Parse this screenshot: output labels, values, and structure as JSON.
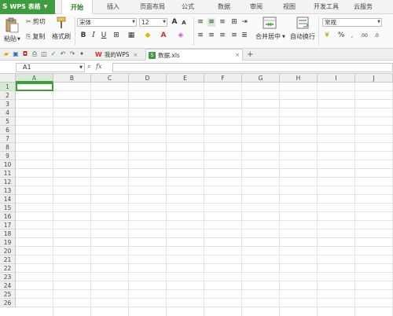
{
  "menu": {
    "app_label": "WPS 表格",
    "tabs": [
      "开始",
      "插入",
      "页面布局",
      "公式",
      "数据",
      "审阅",
      "视图",
      "开发工具",
      "云服务"
    ],
    "active_tab": 0
  },
  "ribbon": {
    "paste": "粘贴",
    "cut": "剪切",
    "copy": "复制",
    "format_painter": "格式刷",
    "font_name": "宋体",
    "font_size": "12",
    "bold": "B",
    "italic": "I",
    "underline": "U",
    "merge_center": "合并居中",
    "wrap_text": "自动换行",
    "number_format": "常规",
    "percent": "%"
  },
  "quick_access": {
    "doc_tabs": [
      {
        "label": "我的WPS",
        "close": "×"
      },
      {
        "label": "数据.xls",
        "close": "×"
      }
    ],
    "new_tab": "+"
  },
  "formula_bar": {
    "cell_ref": "A1",
    "fx": "fx"
  },
  "sheet": {
    "columns": [
      "A",
      "B",
      "C",
      "D",
      "E",
      "F",
      "G",
      "H",
      "I",
      "J"
    ],
    "rows": [
      "1",
      "2",
      "3",
      "4",
      "5",
      "6",
      "7",
      "8",
      "9",
      "10",
      "11",
      "12",
      "13",
      "14",
      "15",
      "16",
      "17",
      "18",
      "19",
      "20",
      "21",
      "22",
      "23",
      "24",
      "25",
      "26"
    ],
    "selected_cell": "A1"
  },
  "colors": {
    "accent": "#3f9b3f",
    "header_bg": "#eef0ee",
    "gridline": "#e3e3e3"
  }
}
